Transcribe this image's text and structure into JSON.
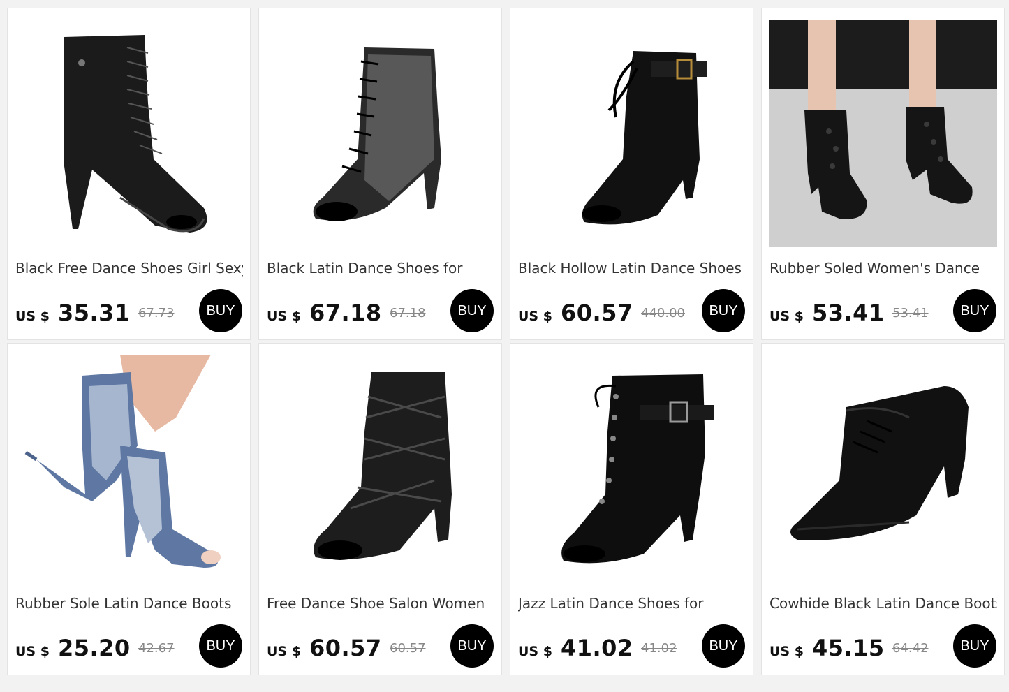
{
  "currency_label": "US $",
  "buy_label": "BUY",
  "products": [
    {
      "title": "Black Free Dance Shoes Girl Sexy",
      "price": "35.31",
      "original_price": "67.73",
      "image": "black-leather-lace-up-peep-toe-boot"
    },
    {
      "title": "Black Latin Dance Shoes for",
      "price": "67.18",
      "original_price": "67.18",
      "image": "black-mesh-lace-up-peep-toe-boot"
    },
    {
      "title": "Black Hollow Latin Dance Shoes",
      "price": "60.57",
      "original_price": "440.00",
      "image": "black-suede-buckle-lace-up-boot"
    },
    {
      "title": "Rubber Soled Women's Dance",
      "price": "53.41",
      "original_price": "53.41",
      "image": "black-lace-ankle-boots-worn-photo"
    },
    {
      "title": "Rubber Sole Latin Dance Boots",
      "price": "25.20",
      "original_price": "42.67",
      "image": "denim-checkered-peep-toe-boots-worn"
    },
    {
      "title": "Free Dance Shoe Salon Women",
      "price": "60.57",
      "original_price": "60.57",
      "image": "black-mesh-strappy-peep-toe-boot"
    },
    {
      "title": "Jazz Latin Dance Shoes for",
      "price": "41.02",
      "original_price": "41.02",
      "image": "black-patent-lace-up-buckle-boot"
    },
    {
      "title": "Cowhide Black Latin Dance Boots",
      "price": "45.15",
      "original_price": "64.42",
      "image": "black-leather-pointed-lace-up-bootie"
    }
  ]
}
